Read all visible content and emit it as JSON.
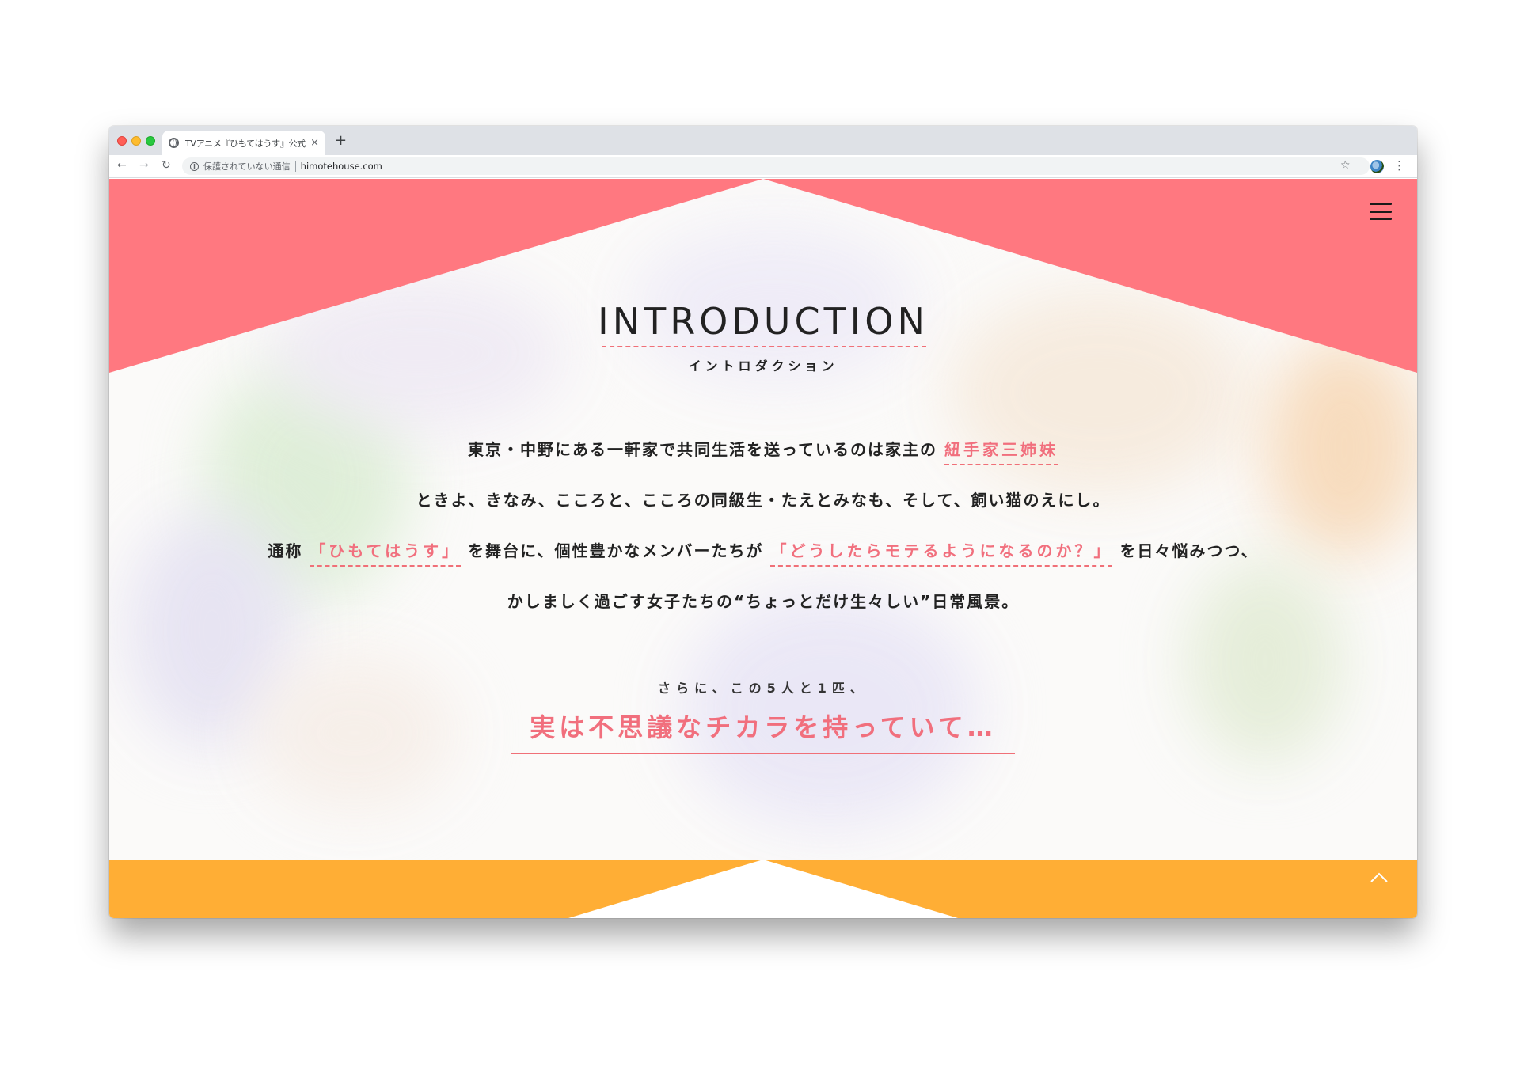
{
  "browser": {
    "tab_title": "TVアニメ『ひもてはうす』公式サ",
    "tab_close": "×",
    "new_tab": "+",
    "security_label": "保護されていない通信",
    "url": "himotehouse.com",
    "nav_back": "←",
    "nav_forward": "→",
    "nav_reload": "↻",
    "star": "☆",
    "menu": "⋮",
    "info": "i"
  },
  "header": {
    "title": "INTRODUCTION",
    "subtitle": "イントロダクション"
  },
  "intro": {
    "line1_a": "東京・中野にある一軒家で共同生活を送っているのは家主の",
    "line1_highlight": "紐手家三姉妹",
    "line2": "ときよ、きなみ、こころと、こころの同級生・たえとみなも、そして、飼い猫のえにし。",
    "line3_a": "通称",
    "line3_highlight1": "「ひもてはうす」",
    "line3_b": "を舞台に、個性豊かなメンバーたちが",
    "line3_highlight2": "「どうしたらモテるようになるのか？」",
    "line3_c": "を日々悩みつつ、",
    "line4": "かしましく過ごす女子たちの“ちょっとだけ生々しい”日常風景。"
  },
  "closing": {
    "note": "さらに、この5人と1匹、",
    "tagline": "実は不思議なチカラを持っていて…"
  },
  "colors": {
    "top_band": "#ff7880",
    "bottom_band": "#ffae35",
    "accent": "#f16f7d"
  },
  "icons": {
    "menu": "hamburger-menu-icon",
    "scroll_top": "chevron-up-icon"
  }
}
